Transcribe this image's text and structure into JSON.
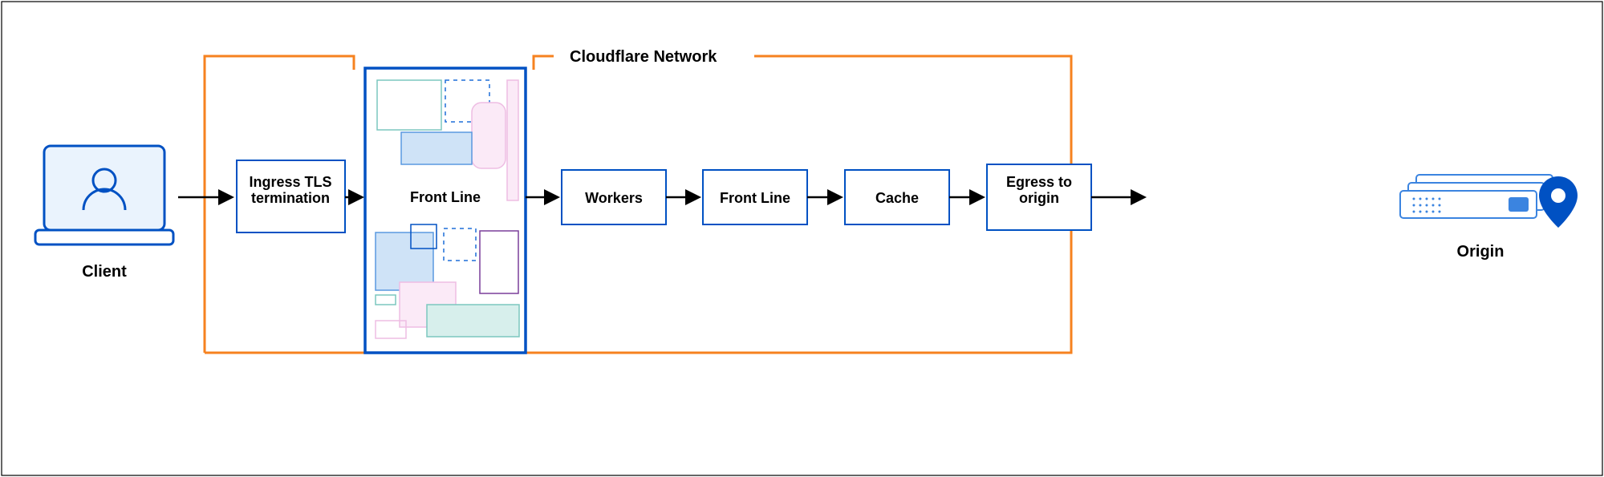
{
  "title": "Cloudflare Network",
  "colors": {
    "brand_orange": "#f6821f",
    "brand_blue": "#0051c3",
    "light_blue": "#cfe3f7",
    "teal": "#7cc7bf",
    "pink": "#eebde3"
  },
  "endpoints": {
    "client": "Client",
    "origin": "Origin"
  },
  "nodes": [
    {
      "id": "ingress",
      "label": "Ingress TLS\ntermination"
    },
    {
      "id": "frontline1",
      "label": "Front Line"
    },
    {
      "id": "workers",
      "label": "Workers"
    },
    {
      "id": "frontline2",
      "label": "Front Line"
    },
    {
      "id": "cache",
      "label": "Cache"
    },
    {
      "id": "egress",
      "label": "Egress to\norigin"
    }
  ],
  "flow": [
    "client → ingress",
    "ingress → frontline1",
    "frontline1 → workers",
    "workers → frontline2",
    "frontline2 → cache",
    "cache → egress",
    "egress → origin"
  ]
}
